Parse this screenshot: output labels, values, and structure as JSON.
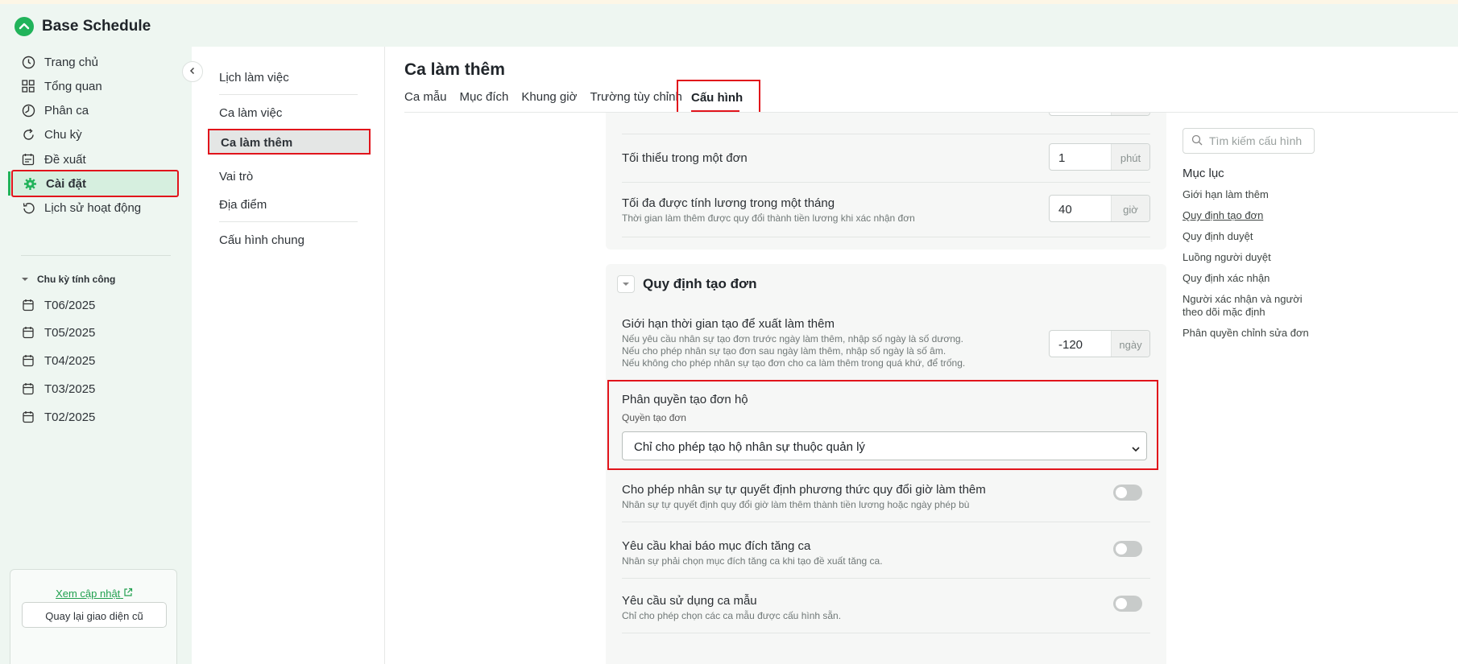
{
  "app": {
    "title": "Base Schedule"
  },
  "sidebar": {
    "items": [
      {
        "label": "Trang chủ",
        "icon": "clock-icon"
      },
      {
        "label": "Tổng quan",
        "icon": "grid-icon"
      },
      {
        "label": "Phân ca",
        "icon": "clock-half-icon"
      },
      {
        "label": "Chu kỳ",
        "icon": "refresh-icon"
      },
      {
        "label": "Đề xuất",
        "icon": "calendar-note-icon"
      },
      {
        "label": "Cài đặt",
        "icon": "gear-icon",
        "active": true
      },
      {
        "label": "Lịch sử hoạt động",
        "icon": "history-icon"
      }
    ],
    "cycle_section": {
      "title": "Chu kỳ tính công",
      "periods": [
        "T06/2025",
        "T05/2025",
        "T04/2025",
        "T03/2025",
        "T02/2025"
      ]
    },
    "update_link": "Xem cập nhật",
    "old_ui_button": "Quay lại giao diện cũ"
  },
  "subnav": {
    "items": [
      "Lịch làm việc",
      "Ca làm việc",
      "Ca làm thêm",
      "Vai trò",
      "Địa điểm",
      "Cấu hình chung"
    ],
    "active": "Ca làm thêm"
  },
  "page": {
    "title": "Ca làm thêm",
    "tabs": [
      "Ca mẫu",
      "Mục đích",
      "Khung giờ",
      "Trường tùy chỉnh",
      "Cấu hình"
    ],
    "active_tab": "Cấu hình"
  },
  "limits": {
    "min_per_request": {
      "label": "Tối thiểu trong một đơn",
      "value": "1",
      "unit": "phút"
    },
    "max_paid_month": {
      "label": "Tối đa được tính lương trong một tháng",
      "desc": "Thời gian làm thêm được quy đổi thành tiền lương khi xác nhận đơn",
      "value": "40",
      "unit": "giờ"
    }
  },
  "creation_rules": {
    "section_title": "Quy định tạo đơn",
    "time_limit": {
      "label": "Giới hạn thời gian tạo để xuất làm thêm",
      "desc_lines": [
        "Nếu yêu cầu nhân sự tạo đơn trước ngày làm thêm, nhập số ngày là số dương.",
        "Nếu cho phép nhân sự tạo đơn sau ngày làm thêm, nhập số ngày là số âm.",
        "Nếu không cho phép nhân sự tạo đơn cho ca làm thêm trong quá khứ, để trống."
      ],
      "value": "-120",
      "unit": "ngày"
    },
    "proxy_permission": {
      "label": "Phân quyền tạo đơn hộ",
      "field_label": "Quyền tạo đơn",
      "selected": "Chỉ cho phép tạo hộ nhân sự thuộc quản lý"
    },
    "toggles": [
      {
        "label": "Cho phép nhân sự tự quyết định phương thức quy đổi giờ làm thêm",
        "desc": "Nhân sự tự quyết định quy đổi giờ làm thêm thành tiền lương hoặc ngày phép bù",
        "on": false
      },
      {
        "label": "Yêu cầu khai báo mục đích tăng ca",
        "desc": "Nhân sự phải chọn mục đích tăng ca khi tạo đề xuất tăng ca.",
        "on": false
      },
      {
        "label": "Yêu cầu sử dụng ca mẫu",
        "desc": "Chỉ cho phép chọn các ca mẫu được cấu hình sẵn.",
        "on": false
      }
    ]
  },
  "right_panel": {
    "search_placeholder": "Tìm kiếm cấu hình",
    "toc_title": "Mục lục",
    "toc": [
      "Giới hạn làm thêm",
      "Quy định tạo đơn",
      "Quy định duyệt",
      "Luồng người duyệt",
      "Quy định xác nhận",
      "Người xác nhận và người theo dõi mặc định",
      "Phân quyền chỉnh sửa đơn"
    ],
    "toc_current": "Quy định tạo đơn"
  },
  "colors": {
    "brand": "#21b35a",
    "highlight": "#e1141b"
  }
}
